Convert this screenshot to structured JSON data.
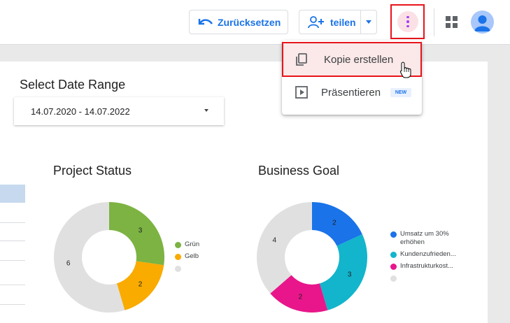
{
  "toolbar": {
    "reset_label": "Zurücksetzen",
    "share_label": "teilen"
  },
  "menu": {
    "items": [
      {
        "label": "Kopie erstellen",
        "icon": "copy-icon",
        "highlighted": true
      },
      {
        "label": "Präsentieren",
        "icon": "present-icon",
        "badge": "NEW"
      }
    ]
  },
  "date_range": {
    "title": "Select Date Range",
    "value": "14.07.2020 - 14.07.2022"
  },
  "colors": {
    "accent": "#1a73e8",
    "highlight_border": "#e8141b",
    "kebab": "#a142f4"
  },
  "chart_data": [
    {
      "type": "pie",
      "title": "Project Status",
      "categories": [
        "Grün",
        "Gelb",
        ""
      ],
      "values": [
        3,
        2,
        6
      ],
      "colors": [
        "#7cb342",
        "#f9ab00",
        "#e0e0e0"
      ],
      "legend": "right"
    },
    {
      "type": "pie",
      "title": "Business Goal",
      "categories": [
        "Umsatz um 30% erhöhen",
        "Kundenzufrieden...",
        "Infrastrukturkost...",
        ""
      ],
      "values": [
        2,
        3,
        2,
        4
      ],
      "colors": [
        "#1a73e8",
        "#12b5cb",
        "#e8168a",
        "#e0e0e0"
      ],
      "legend": "right"
    }
  ]
}
